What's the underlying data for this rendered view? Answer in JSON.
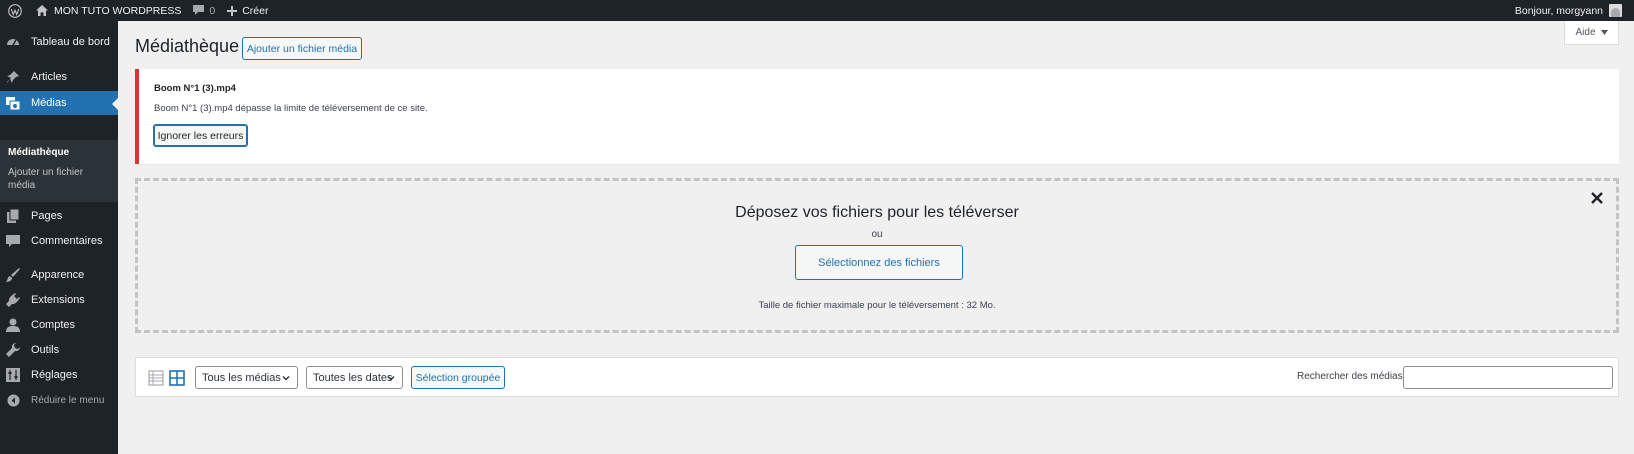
{
  "admin_bar": {
    "site_name": "MON TUTO WORDPRESS",
    "comments_count": "0",
    "new_label": "Créer",
    "greeting": "Bonjour, morgyann"
  },
  "sidebar": {
    "items": [
      {
        "label": "Tableau de bord",
        "icon": "dashboard-icon"
      },
      {
        "label": "Articles",
        "icon": "pin-icon"
      },
      {
        "label": "Médias",
        "icon": "media-icon"
      },
      {
        "label": "Pages",
        "icon": "page-icon"
      },
      {
        "label": "Commentaires",
        "icon": "comment-icon"
      },
      {
        "label": "Apparence",
        "icon": "brush-icon"
      },
      {
        "label": "Extensions",
        "icon": "plugin-icon"
      },
      {
        "label": "Comptes",
        "icon": "user-icon"
      },
      {
        "label": "Outils",
        "icon": "wrench-icon"
      },
      {
        "label": "Réglages",
        "icon": "settings-icon"
      }
    ],
    "submenu": [
      {
        "label": "Médiathèque"
      },
      {
        "label": "Ajouter un fichier média"
      }
    ],
    "collapse_label": "Réduire le menu"
  },
  "header": {
    "title": "Médiathèque",
    "add_new_label": "Ajouter un fichier média",
    "help_label": "Aide"
  },
  "error_notice": {
    "filename": "Boom N°1 (3).mp4",
    "message": "Boom N°1 (3).mp4 dépasse la limite de téléversement de ce site.",
    "dismiss_label": "Ignorer les erreurs"
  },
  "uploader": {
    "drop_text": "Déposez vos fichiers pour les téléverser",
    "or_text": "ou",
    "select_label": "Sélectionnez des fichiers",
    "max_size_text": "Taille de fichier maximale pour le téléversement : 32 Mo."
  },
  "toolbar": {
    "type_filter": "Tous les médias",
    "date_filter": "Toutes les dates",
    "bulk_label": "Sélection groupée",
    "search_label": "Rechercher des médias",
    "search_value": ""
  },
  "colors": {
    "admin_dark": "#1d2327",
    "accent": "#2271b1",
    "error": "#d63638"
  }
}
